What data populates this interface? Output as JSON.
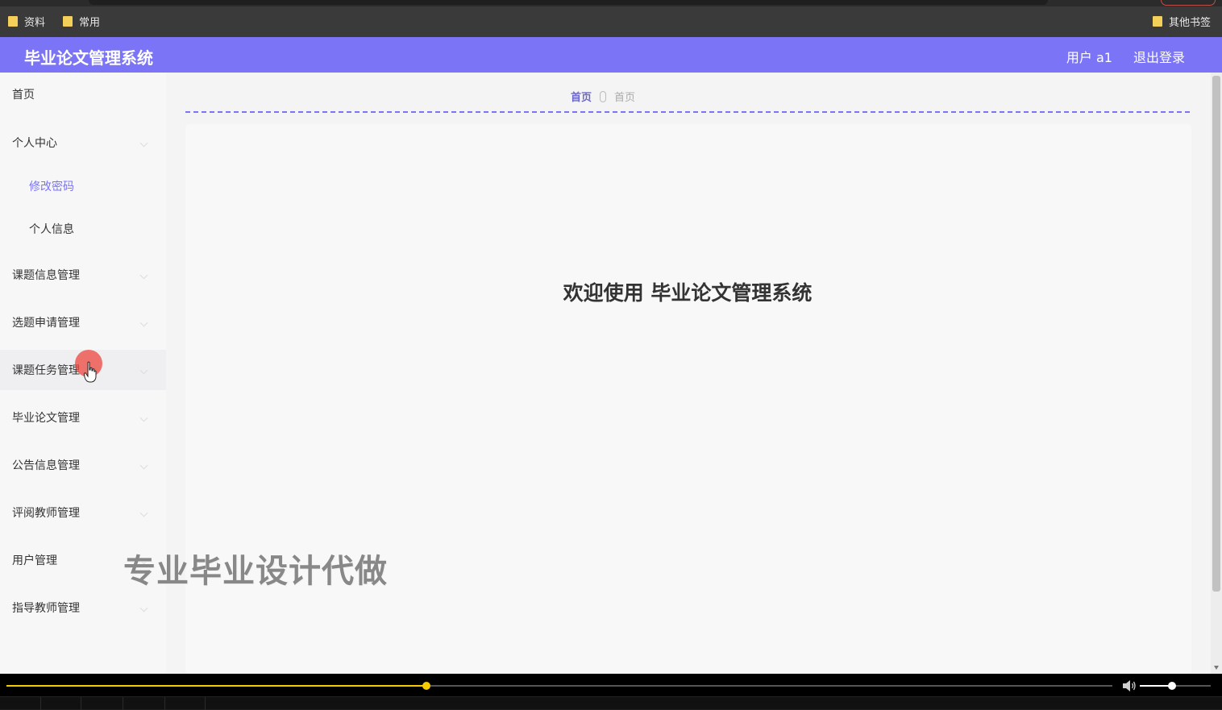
{
  "browser": {
    "bookmarks": [
      {
        "label": "资料"
      },
      {
        "label": "常用"
      },
      {
        "label": "其他书签"
      }
    ]
  },
  "header": {
    "title": "毕业论文管理系统",
    "user_label": "用户 a1",
    "logout_label": "退出登录",
    "accent_color": "#7b74f6"
  },
  "sidebar": {
    "items": [
      {
        "label": "首页"
      },
      {
        "label": "个人中心"
      },
      {
        "label": "修改密码"
      },
      {
        "label": "个人信息"
      },
      {
        "label": "课题信息管理"
      },
      {
        "label": "选题申请管理"
      },
      {
        "label": "课题任务管理"
      },
      {
        "label": "毕业论文管理"
      },
      {
        "label": "公告信息管理"
      },
      {
        "label": "评阅教师管理"
      },
      {
        "label": "用户管理"
      },
      {
        "label": "指导教师管理"
      }
    ]
  },
  "breadcrumb": {
    "home": "首页",
    "current": "首页"
  },
  "main": {
    "welcome": "欢迎使用 毕业论文管理系统"
  },
  "overlay": {
    "watermark": "专业毕业设计代做"
  },
  "player": {
    "progress": 0.38,
    "volume": 0.45,
    "seek_color": "#f5cc00"
  }
}
